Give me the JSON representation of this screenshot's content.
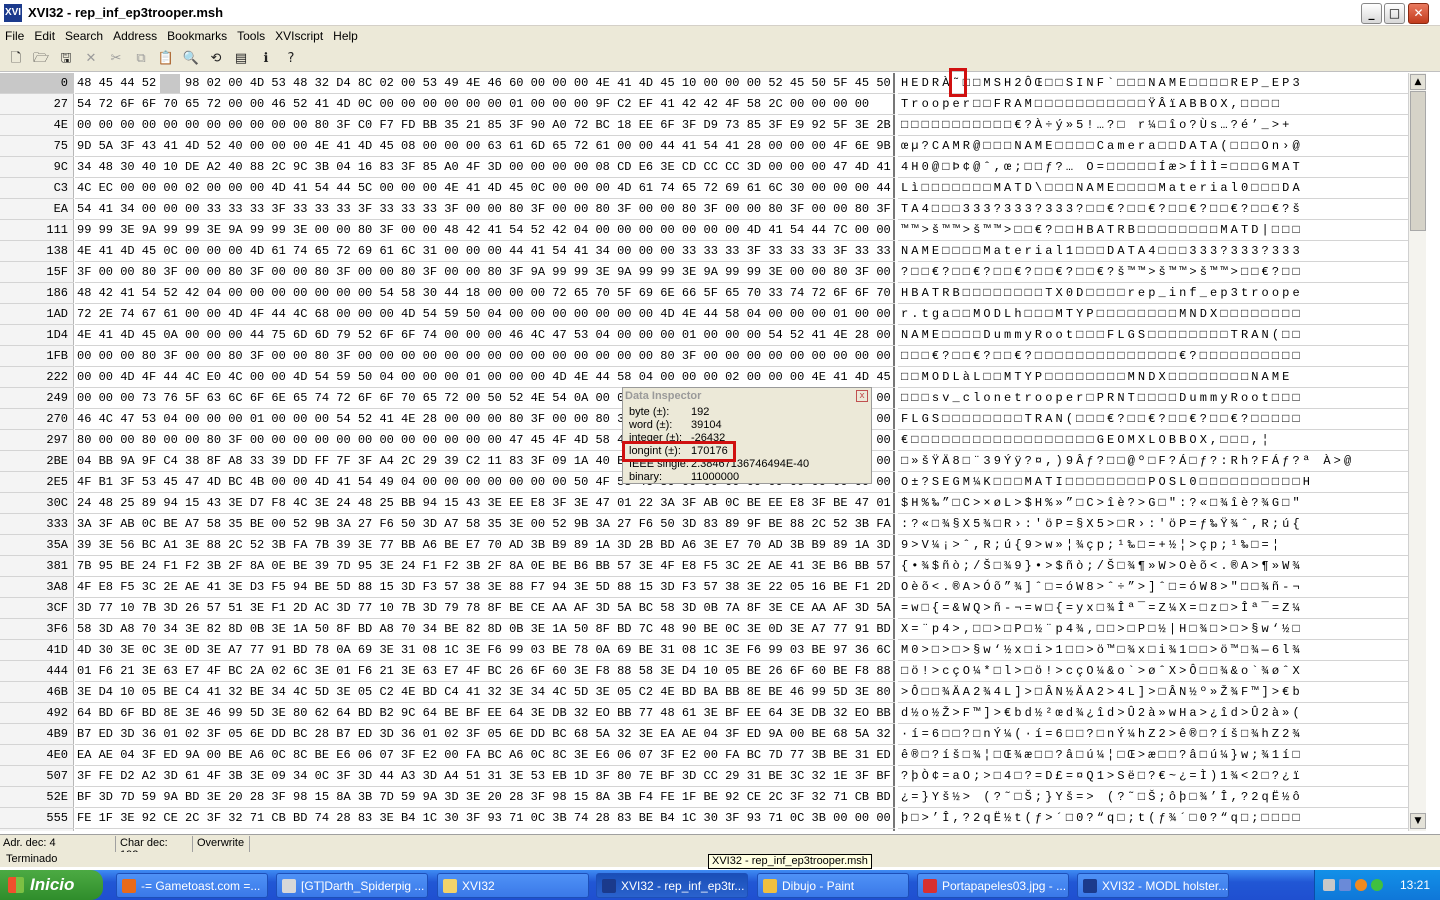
{
  "window": {
    "title": "XVI32 - rep_inf_ep3trooper.msh",
    "app_icon": "XVI",
    "min_label": "_",
    "max_label": "□",
    "close_label": "✕"
  },
  "menu": [
    "File",
    "Edit",
    "Search",
    "Address",
    "Bookmarks",
    "Tools",
    "XVIscript",
    "Help"
  ],
  "toolbar_icons": [
    "new-file-icon",
    "open-folder-icon",
    "save-disk-icon",
    "delete-icon",
    "cut-icon",
    "copy-icon",
    "paste-icon",
    "find-icon",
    "find-replace-icon",
    "goto-icon",
    "info-icon",
    "help-icon"
  ],
  "rows": [
    {
      "addr": "0",
      "hex": "48 45 44 52 C0 98 02 00 4D 53 48 32 D4 8C 02 00 53 49 4E 46 60 00 00 00 4E 41 4D 45 10 00 00 00 52 45 50 5F 45 50 33",
      "chars": "HEDRÀ˜□□MSH2ÔŒ□□SINF`□□□NAME□□□□REP_EP3"
    },
    {
      "addr": "27",
      "hex": "54 72 6F 6F 70 65 72 00 00 46 52 41 4D 0C 00 00 00 00 00 00 01 00 00 00 9F C2 EF 41 42 42 4F 58 2C 00 00 00 00",
      "chars": "Trooper□□FRAM□□□□□□□□□□□ŸÂïABBOX,□□□□"
    },
    {
      "addr": "4E",
      "hex": "00 00 00 00 00 00 00 00 00 00 00 80 3F C0 F7 FD BB 35 21 85 3F 90 A0 72 BC 18 EE 6F 3F D9 73 85 3F E9 92 5F 3E 2B",
      "chars": "□□□□□□□□□□□€?À÷ý»5!…?□ r¼□îo?Ùs…?é’_>+"
    },
    {
      "addr": "75",
      "hex": "9D 5A 3F 43 41 4D 52 40 00 00 00 4E 41 4D 45 08 00 00 00 63 61 6D 65 72 61 00 00 44 41 54 41 28 00 00 00 4F 6E 9B 40",
      "chars": "œµ?CAMR@□□□NAME□□□□Camera□□DATA(□□□On›@"
    },
    {
      "addr": "9C",
      "hex": "34 48 30 40 10 DE A2 40 88 2C 9C 3B 04 16 83 3F 85 A0 4F 3D 00 00 00 00 08 CD E6 3E CD CC CC 3D 00 00 00 47 4D 41 54",
      "chars": "4H0@□Þ¢@ˆ,œ;□□ƒ?… O=□□□□□Íæ>ÍÌÌ=□□□GMAT"
    },
    {
      "addr": "C3",
      "hex": "4C EC 00 00 00 02 00 00 00 4D 41 54 44 5C 00 00 00 4E 41 4D 45 0C 00 00 00 4D 61 74 65 72 69 61 6C 30 00 00 00 44 41",
      "chars": "Lì□□□□□□□MATD\\□□□NAME□□□□Material0□□□DA"
    },
    {
      "addr": "EA",
      "hex": "54 41 34 00 00 00 33 33 33 3F 33 33 33 3F 33 33 33 3F 00 00 80 3F 00 00 80 3F 00 00 80 3F 00 00 80 3F 00 00 80 3F 9A",
      "chars": "TA4□□□333?333?333?□□€?□□€?□□€?□□€?□□€?š"
    },
    {
      "addr": "111",
      "hex": "99 99 3E 9A 99 99 3E 9A 99 99 3E 00 00 80 3F 00 00 48 42 41 54 52 42 04 00 00 00 00 00 00 00 4D 41 54 44 7C 00 00 00",
      "chars": "™™>š™™>š™™>□□€?□□HBATRB□□□□□□□□MATD|□□□"
    },
    {
      "addr": "138",
      "hex": "4E 41 4D 45 0C 00 00 00 4D 61 74 65 72 69 61 6C 31 00 00 00 44 41 54 41 34 00 00 00 33 33 33 3F 33 33 33 3F 33 33 33",
      "chars": "NAME□□□□Material1□□□DATA4□□□333?333?333"
    },
    {
      "addr": "15F",
      "hex": "3F 00 00 80 3F 00 00 80 3F 00 00 80 3F 00 00 80 3F 00 00 80 3F 9A 99 99 3E 9A 99 99 3E 9A 99 99 3E 00 00 80 3F 00 00",
      "chars": "?□□€?□□€?□□€?□□€?□□€?š™™>š™™>š™™>□□€?□□"
    },
    {
      "addr": "186",
      "hex": "48 42 41 54 52 42 04 00 00 00 00 00 00 00 54 58 30 44 18 00 00 00 72 65 70 5F 69 6E 66 5F 65 70 33 74 72 6F 6F 70 65",
      "chars": "HBATRB□□□□□□□□TX0D□□□□rep_inf_ep3troope"
    },
    {
      "addr": "1AD",
      "hex": "72 2E 74 67 61 00 00 4D 4F 44 4C 68 00 00 00 4D 54 59 50 04 00 00 00 00 00 00 00 4D 4E 44 58 04 00 00 00 01 00 00 00",
      "chars": "r.tga□□MODLh□□□MTYP□□□□□□□□MNDX□□□□□□□□"
    },
    {
      "addr": "1D4",
      "hex": "4E 41 4D 45 0A 00 00 00 44 75 6D 6D 79 52 6F 6F 74 00 00 00 46 4C 47 53 04 00 00 00 01 00 00 00 54 52 41 4E 28 00 00",
      "chars": "NAME□□□□DummyRoot□□□FLGS□□□□□□□□TRAN(□□"
    },
    {
      "addr": "1FB",
      "hex": "00 00 00 80 3F 00 00 80 3F 00 00 80 3F 00 00 00 00 00 00 00 00 00 00 00 00 00 00 80 3F 00 00 00 00 00 00 00 00 00 00",
      "chars": "□□□€?□□€?□□€?□□□□□□□□□□□□□□€?□□□□□□□□□□"
    },
    {
      "addr": "222",
      "hex": "00 00 4D 4F 44 4C E0 4C 00 00 4D 54 59 50 04 00 00 00 01 00 00 00 4D 4E 44 58 04 00 00 00 02 00 00 00 4E 41 4D 45",
      "chars": "□□MODLàL□□MTYP□□□□□□□□MNDX□□□□□□□□NAME"
    },
    {
      "addr": "249",
      "hex": "00 00 00 73 76 5F 63 6C 6F 6E 65 74 72 6F 6F 70 65 72 00 50 52 4E 54 0A 00 00 00 44 75 6D 6D 79 52 6F 6F 74 00 00 00",
      "chars": "□□□sv_clonetrooper□PRNT□□□□DummyRoot□□□"
    },
    {
      "addr": "270",
      "hex": "46 4C 47 53 04 00 00 00 01 00 00 00 54 52 41 4E 28 00 00 00 80 3F 00 00 80 3F 00 00 80 3F 00 00 80 3F 00 00 00 00 00",
      "chars": "FLGS□□□□□□□□TRAN(□□□€?□□€?□□€?□□€?□□□□□"
    },
    {
      "addr": "297",
      "hex": "80 00 00 80 00 00 80 3F 00 00 00 00 00 00 00 00 00 00 00 00 47 45 4F 4D 58 4C 4F 42 42 4F 58 2C 00 00 00 00 00 00 A6",
      "chars": "€□□□□□□□□□□□□□□□□□□GEOMXLOBBOX,□□□,¦"
    },
    {
      "addr": "2BE",
      "hex": "04 BB 9A 9F C4 38 8F A8 33 39 DD FF 7F 3F A4 2C 29 39 C2 11 83 3F 09 1A 40 BA 9A 11 46 3F 00 00 00 00 00 00 00 00 40",
      "chars": "□»šŸÄ8□¨39Ýÿ?¤,)9Âƒ?□□@º□F?Á□ƒ?:Rh?FÁƒ?ª À>@"
    },
    {
      "addr": "2E5",
      "hex": "4F B1 3F 53 45 47 4D BC 4B 00 00 4D 41 54 49 04 00 00 00 00 00 00 00 50 4F 53 4C 30 00 00 00 00 00 00 00 00 00 00 48",
      "chars": "O±?SEGM¼K□□□MATI□□□□□□□□POSL0□□□□□□□□□□H"
    },
    {
      "addr": "30C",
      "hex": "24 48 25 89 94 15 43 3E D7 F8 4C 3E 24 48 25 BB 94 15 43 3E EE E8 3F 3E 47 01 22 3A 3F AB 0C BE EE E8 3F BE 47 01 22",
      "chars": "$H%‰”□C>×øL>$H%»”□C>îè?>G□\":?«□¾îè?¾G□\""
    },
    {
      "addr": "333",
      "hex": "3A 3F AB 0C BE A7 58 35 BE 00 52 9B 3A 27 F6 50 3D A7 58 35 3E 00 52 9B 3A 27 F6 50 3D 83 89 9F BE 88 2C 52 3B FA 7B",
      "chars": ":?«□¾§X5¾□R›:'öP=§X5>□R›:'öP=ƒ‰Ÿ¾ˆ,R;ú{"
    },
    {
      "addr": "35A",
      "hex": "39 3E 56 BC A1 3E 88 2C 52 3B FA 7B 39 3E 77 BB A6 BE E7 70 AD 3B B9 89 1A 3D 2B BD A6 3E E7 70 AD 3B B9 89 1A 3D A6",
      "chars": "9>V¼¡>ˆ,R;ú{9>w»¦¾çp­;¹‰□=+½¦>çp­;¹‰□=¦"
    },
    {
      "addr": "381",
      "hex": "7B 95 BE 24 F1 F2 3B 2F 8A 0E BE 39 7D 95 3E 24 F1 F2 3B 2F 8A 0E BE B6 BB 57 3E 4F E8 F5 3C 2E AE 41 3E B6 BB 57 BE",
      "chars": "{•¾$ñò;/Š□¾9}•>$ñò;/Š□¾¶»W>Oèõ<.®A>¶»W¾"
    },
    {
      "addr": "3A8",
      "hex": "4F E8 F5 3C 2E AE 41 3E D3 F5 94 BE 5D 88 15 3D F3 57 38 3E 88 F7 94 3E 5D 88 15 3D F3 57 38 3E 22 05 16 BE F1 2D AC",
      "chars": "Oèõ<.®A>Óõ”¾]ˆ□=óW8>ˆ÷”>]ˆ□=óW8>\"□□¾ñ-¬"
    },
    {
      "addr": "3CF",
      "hex": "3D 77 10 7B 3D 26 57 51 3E F1 2D AC 3D 77 10 7B 3D 79 78 8F BE CE AA AF 3D 5A BC 58 3D 0B 7A 8F 3E CE AA AF 3D 5A BC",
      "chars": "=w□{=&WQ>ñ-¬=w□{=yx□¾Îª¯=Z¼X=□z□>Îª¯=Z¼"
    },
    {
      "addr": "3F6",
      "hex": "58 3D A8 70 34 3E 82 8D 0B 3E 1A 50 8F BD A8 70 34 BE 82 8D 0B 3E 1A 50 8F BD 7C 48 90 BE 0C 3E 0D 3E A7 77 91 BD 0E",
      "chars": "X=¨p4>‚□□>□P□½¨p4¾‚□□>□P□½|H□¾□>□>§w‘½□"
    },
    {
      "addr": "41D",
      "hex": "4D 30 3E 0C 3E 0D 3E A7 77 91 BD 78 0A 69 3E 31 08 1C 3E F6 99 03 BE 78 0A 69 BE 31 08 1C 3E F6 99 03 BE 97 36 6C BE",
      "chars": "M0>□>□>§w‘½x□i>1□□>ö™□¾x□i¾1□□>ö™□¾—6l¾"
    },
    {
      "addr": "444",
      "hex": "01 F6 21 3E 63 E7 4F BC 2A 02 6C 3E 01 F6 21 3E 63 E7 4F BC 26 6F 60 3E F8 88 58 3E D4 10 05 BE 26 6F 60 BE F8 88 58",
      "chars": "□ö!>cçO¼*□l>□ö!>cçO¼&o`>øˆX>Ô□□¾&o`¾øˆX"
    },
    {
      "addr": "46B",
      "hex": "3E D4 10 05 BE C4 41 32 BE 34 4C 5D 3E 05 C2 4E BD C4 41 32 3E 34 4C 5D 3E 05 C2 4E BD BA BB 8E BE 46 99 5D 3E 80 62",
      "chars": ">Ô□□¾ÄA2¾4L]>□ÂN½ÄA2>4L]>□ÂN½º»Ž¾F™]>€b"
    },
    {
      "addr": "492",
      "hex": "64 BD 6F BD 8E 3E 46 99 5D 3E 80 62 64 BD B2 9C 64 BE BF EE 64 3E DB 32 EO BB 77 48 61 3E BF EE 64 3E DB 32 EO BB 26",
      "chars": "d½o½Ž>F™]>€bd½²œd¾¿îd>Û2à»wHa>¿îd>Û2à»("
    },
    {
      "addr": "4B9",
      "hex": "B7 ED 3D 36 01 02 3F 05 6E DD BC 28 B7 ED 3D 36 01 02 3F 05 6E DD BC 68 5A 32 3E EA AE 04 3F ED 9A 00 BE 68 5A 32 BE",
      "chars": "·í=6□□?□nÝ¼(·í=6□□?□nÝ¼hZ2>ê®□?íš□¾hZ2¾"
    },
    {
      "addr": "4E0",
      "hex": "EA AE 04 3F ED 9A 00 BE A6 0C 8C BE E6 06 07 3F E2 00 FA BC A6 0C 8C 3E E6 06 07 3F E2 00 FA BC 7D 77 3B BE 31 ED 0B",
      "chars": "ê®□?íš□¾¦□Œ¾æ□□?â□ú¼¦□Œ>æ□□?â□ú¼}w;¾1í□"
    },
    {
      "addr": "507",
      "hex": "3F FE D2 A2 3D 61 4F 3B 3E 09 34 0C 3F 3D 44 A3 3D A4 51 31 3E 53 EB 1D 3F 80 7E BF 3D CC 29 31 BE 3C 32 1E 3F BF EF",
      "chars": "?þÒ¢=aO;>□4□?=D£=¤Q1>Së□?€~¿=Ì)1¾<2□?¿ï"
    },
    {
      "addr": "52E",
      "hex": "BF 3D 7D 59 9A BD 3E 20 28 3F 98 15 8A 3B 7D 59 9A 3D 3E 20 28 3F 98 15 8A 3B F4 FE 1F BE 92 CE 2C 3F 32 71 CB BD F4",
      "chars": "¿=}Yš½> (?˜□Š;}Yš=> (?˜□Š;ôþ□¾’Î,?2qË½ô"
    },
    {
      "addr": "555",
      "hex": "FE 1F 3E 92 CE 2C 3F 32 71 CB BD 74 28 83 3E B4 1C 30 3F 93 71 0C 3B 74 28 83 BE B4 1C 30 3F 93 71 0C 3B 00 00 00 00",
      "chars": "þ□>’Î,?2qË½t(ƒ>´□0?“q□;t(ƒ¾´□0?“q□;□□□□"
    }
  ],
  "inspector": {
    "title": "Data Inspector",
    "close_label": "x",
    "fields": [
      {
        "label": "byte (±):",
        "value": "192"
      },
      {
        "label": "word (±):",
        "value": "39104"
      },
      {
        "label": "integer (±):",
        "value": "-26432"
      },
      {
        "label": "longint (±):",
        "value": "170176"
      },
      {
        "label": "IEEE single:",
        "value": "2.38467136746494E-40"
      },
      {
        "label": "binary:",
        "value": "11000000"
      }
    ]
  },
  "status": {
    "adr": "Adr. dec: 4",
    "char": "Char dec: 192",
    "mode": "Overwrite",
    "terminated": "Terminado"
  },
  "tooltip": "XVI32 - rep_inf_ep3trooper.msh",
  "taskbar": {
    "start": "Inicio",
    "tasks": [
      {
        "label": "-= Gametoast.com =...",
        "icon_color": "#e86a1a"
      },
      {
        "label": "[GT]Darth_Spiderpig ...",
        "icon_color": "#d8d8d8"
      },
      {
        "label": "XVI32",
        "icon_color": "#f2d36a"
      },
      {
        "label": "XVI32 - rep_inf_ep3tr...",
        "icon_color": "#1b3a8c"
      },
      {
        "label": "Dibujo - Paint",
        "icon_color": "#f0c040"
      },
      {
        "label": "Portapapeles03.jpg - ...",
        "icon_color": "#d83030"
      },
      {
        "label": "XVI32 - MODL holster...",
        "icon_color": "#1b3a8c"
      }
    ],
    "clock": "13:21"
  }
}
